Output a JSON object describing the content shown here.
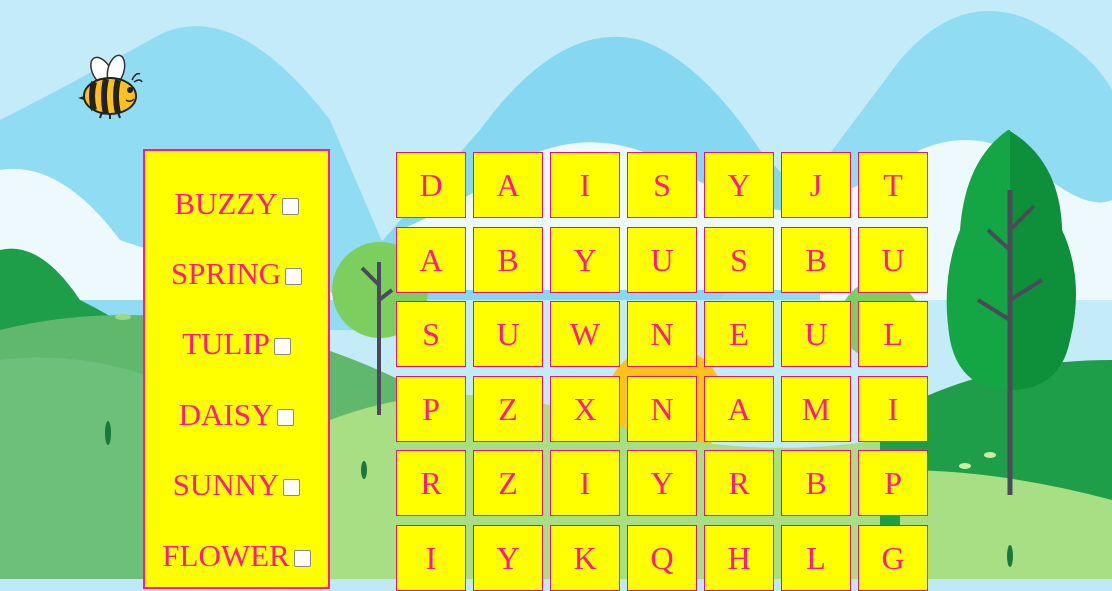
{
  "colors": {
    "panel_bg": "#ffff00",
    "text": "#ff1a8c",
    "cell_border": "#e0147a"
  },
  "word_list": [
    {
      "word": "BUZZY",
      "checked": false
    },
    {
      "word": "SPRING",
      "checked": false
    },
    {
      "word": "TULIP",
      "checked": false
    },
    {
      "word": "DAISY",
      "checked": false
    },
    {
      "word": "SUNNY",
      "checked": false
    },
    {
      "word": "FLOWER",
      "checked": false
    }
  ],
  "grid": [
    [
      "D",
      "A",
      "I",
      "S",
      "Y",
      "J",
      "T"
    ],
    [
      "A",
      "B",
      "Y",
      "U",
      "S",
      "B",
      "U"
    ],
    [
      "S",
      "U",
      "W",
      "N",
      "E",
      "U",
      "L"
    ],
    [
      "P",
      "Z",
      "X",
      "N",
      "A",
      "M",
      "I"
    ],
    [
      "R",
      "Z",
      "I",
      "Y",
      "R",
      "B",
      "P"
    ],
    [
      "I",
      "Y",
      "K",
      "Q",
      "H",
      "L",
      "G"
    ]
  ]
}
